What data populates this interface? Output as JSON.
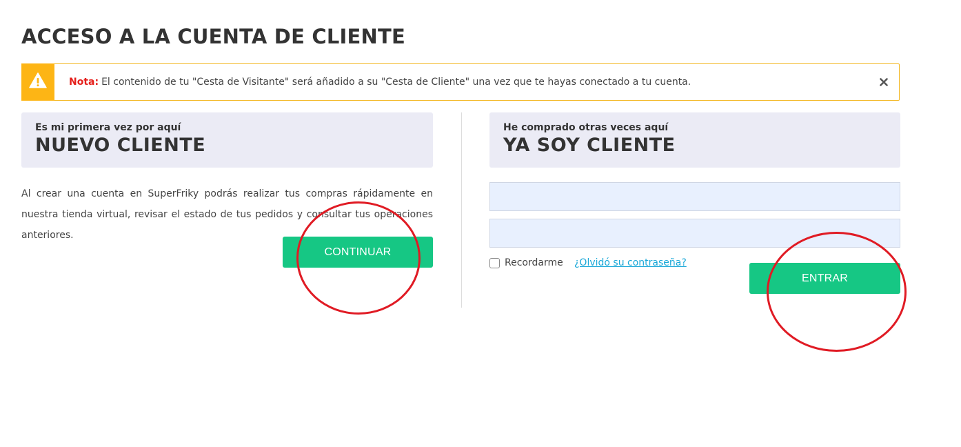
{
  "page": {
    "title": "ACCESO A LA CUENTA DE CLIENTE"
  },
  "alert": {
    "icon": "warning-icon",
    "note_label": "Nota:",
    "message": "El contenido de tu \"Cesta de Visitante\" será añadido a su \"Cesta de Cliente\" una vez que te hayas conectado a tu cuenta.",
    "close_icon": "close-icon",
    "color": "#fdb515"
  },
  "new_customer": {
    "subtitle": "Es mi primera vez por aquí",
    "title": "NUEVO CLIENTE",
    "description": "Al crear una cuenta en SuperFriky podrás realizar tus compras rápidamente en nuestra tienda virtual, revisar el estado de tus pedidos y consultar tus operaciones anteriores.",
    "button_label": "CONTINUAR"
  },
  "existing_customer": {
    "subtitle": "He comprado otras veces aquí",
    "title": "YA SOY CLIENTE",
    "email_value": "",
    "password_value": "",
    "remember_label": "Recordarme",
    "remember_checked": false,
    "forgot_label": "¿Olvidó su contraseña?",
    "button_label": "ENTRAR"
  },
  "colors": {
    "primary_button": "#16c784",
    "annotation": "#e01b24",
    "note_text": "#e5201c",
    "link": "#1aa8d8"
  }
}
